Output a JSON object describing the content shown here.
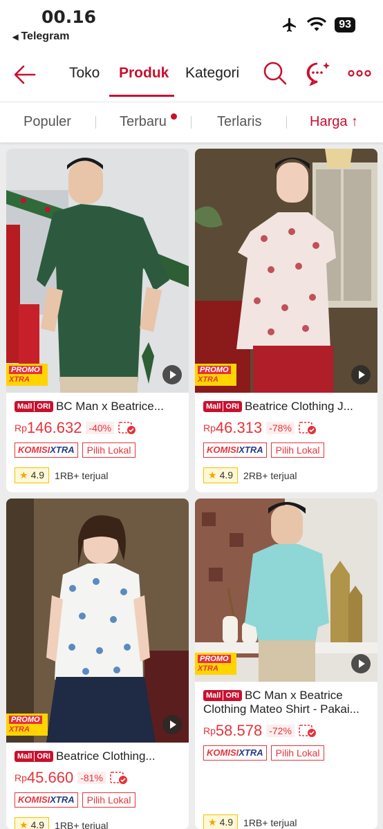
{
  "status_bar": {
    "time": "00.16",
    "back_app": "Telegram",
    "battery": "93"
  },
  "nav": {
    "tabs": [
      "Toko",
      "Produk",
      "Kategori"
    ],
    "active_tab": "Produk"
  },
  "sort": {
    "items": [
      "Populer",
      "Terbaru",
      "Terlaris",
      "Harga ↑"
    ],
    "active": "Harga ↑"
  },
  "colors": {
    "accent": "#c8102e",
    "price": "#e5333a"
  },
  "products": [
    {
      "title": "BC Man x Beatrice...",
      "currency": "Rp",
      "price": "146.632",
      "discount": "-40%",
      "rating": "4.9",
      "sold": "1RB+ terjual",
      "badge_mall": "Mall",
      "badge_ori": "ORI",
      "promo_1": "PROMO",
      "promo_2": "XTRA",
      "tag_komisi_a": "KOMISI",
      "tag_komisi_b": "XTRA",
      "tag_lokal": "Pilih Lokal"
    },
    {
      "title": "Beatrice Clothing J...",
      "currency": "Rp",
      "price": "46.313",
      "discount": "-78%",
      "rating": "4.9",
      "sold": "2RB+ terjual",
      "badge_mall": "Mall",
      "badge_ori": "ORI",
      "promo_1": "PROMO",
      "promo_2": "XTRA",
      "tag_komisi_a": "KOMISI",
      "tag_komisi_b": "XTRA",
      "tag_lokal": "Pilih Lokal"
    },
    {
      "title": "Beatrice Clothing...",
      "currency": "Rp",
      "price": "45.660",
      "discount": "-81%",
      "rating": "4.9",
      "sold": "1RB+ terjual",
      "badge_mall": "Mall",
      "badge_ori": "ORI",
      "promo_1": "PROMO",
      "promo_2": "XTRA",
      "tag_komisi_a": "KOMISI",
      "tag_komisi_b": "XTRA",
      "tag_lokal": "Pilih Lokal"
    },
    {
      "title_1": "BC Man x Beatrice",
      "title_2": "Clothing Mateo Shirt - Pakai...",
      "currency": "Rp",
      "price": "58.578",
      "discount": "-72%",
      "rating": "4.9",
      "sold": "1RB+ terjual",
      "badge_mall": "Mall",
      "badge_ori": "ORI",
      "promo_1": "PROMO",
      "promo_2": "XTRA",
      "tag_komisi_a": "KOMISI",
      "tag_komisi_b": "XTRA",
      "tag_lokal": "Pilih Lokal"
    }
  ]
}
